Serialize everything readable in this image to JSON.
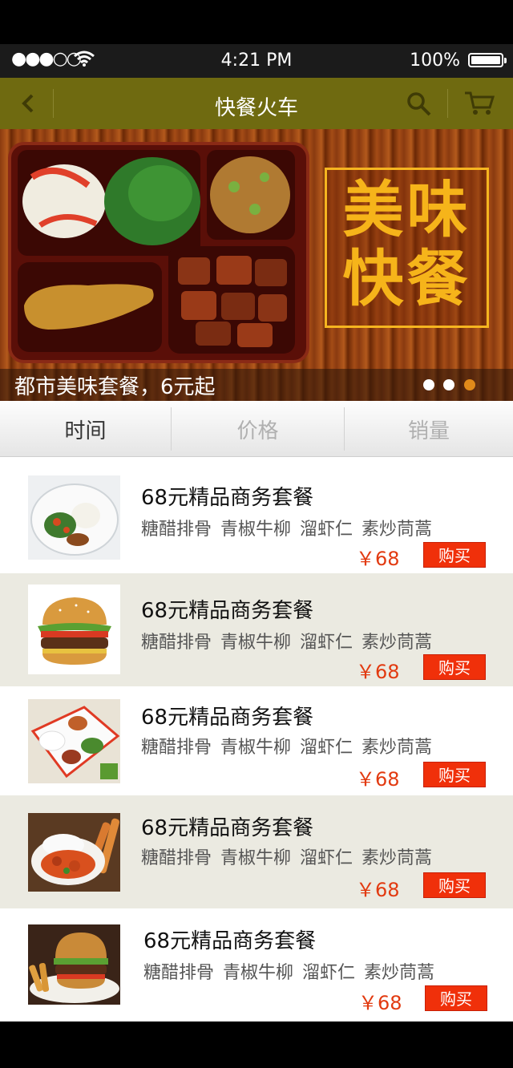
{
  "status_bar": {
    "signal": "●●●○○",
    "time": "4:21 PM",
    "battery": "100%"
  },
  "nav": {
    "title": "快餐火车",
    "back_icon": "chevron-left-icon",
    "search_icon": "search-icon",
    "cart_icon": "cart-icon",
    "bar_color": "#6f6a10"
  },
  "banner": {
    "stamp_line1": "美味",
    "stamp_line2": "快餐",
    "caption": "都市美味套餐，6元起",
    "pager": {
      "count": 3,
      "active": 3
    }
  },
  "sort_tabs": [
    {
      "label": "时间",
      "active": true
    },
    {
      "label": "价格",
      "active": false
    },
    {
      "label": "销量",
      "active": false
    }
  ],
  "items": [
    {
      "name": "68元精品商务套餐",
      "dishes": "糖醋排骨 青椒牛柳 溜虾仁 素炒茼蒿",
      "price": "￥68",
      "buy": "购买",
      "image": "rice-plate"
    },
    {
      "name": "68元精品商务套餐",
      "dishes": "糖醋排骨 青椒牛柳 溜虾仁 素炒茼蒿",
      "price": "￥68",
      "buy": "购买",
      "image": "burger"
    },
    {
      "name": "68元精品商务套餐",
      "dishes": "糖醋排骨 青椒牛柳 溜虾仁 素炒茼蒿",
      "price": "￥68",
      "buy": "购买",
      "image": "bento-tray"
    },
    {
      "name": "68元精品商务套餐",
      "dishes": "糖醋排骨 青椒牛柳 溜虾仁 素炒茼蒿",
      "price": "￥68",
      "buy": "购买",
      "image": "curry-rice"
    },
    {
      "name": "68元精品商务套餐",
      "dishes": "糖醋排骨 青椒牛柳 溜虾仁 素炒茼蒿",
      "price": "￥68",
      "buy": "购买",
      "image": "burger-fries"
    }
  ]
}
